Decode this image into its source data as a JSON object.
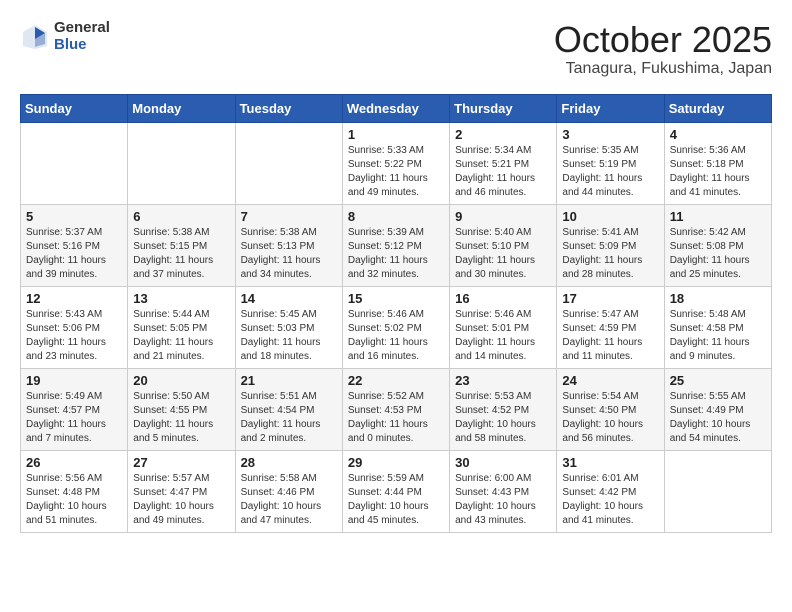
{
  "header": {
    "logo_general": "General",
    "logo_blue": "Blue",
    "month_title": "October 2025",
    "location": "Tanagura, Fukushima, Japan"
  },
  "weekdays": [
    "Sunday",
    "Monday",
    "Tuesday",
    "Wednesday",
    "Thursday",
    "Friday",
    "Saturday"
  ],
  "weeks": [
    [
      {
        "day": "",
        "info": ""
      },
      {
        "day": "",
        "info": ""
      },
      {
        "day": "",
        "info": ""
      },
      {
        "day": "1",
        "info": "Sunrise: 5:33 AM\nSunset: 5:22 PM\nDaylight: 11 hours\nand 49 minutes."
      },
      {
        "day": "2",
        "info": "Sunrise: 5:34 AM\nSunset: 5:21 PM\nDaylight: 11 hours\nand 46 minutes."
      },
      {
        "day": "3",
        "info": "Sunrise: 5:35 AM\nSunset: 5:19 PM\nDaylight: 11 hours\nand 44 minutes."
      },
      {
        "day": "4",
        "info": "Sunrise: 5:36 AM\nSunset: 5:18 PM\nDaylight: 11 hours\nand 41 minutes."
      }
    ],
    [
      {
        "day": "5",
        "info": "Sunrise: 5:37 AM\nSunset: 5:16 PM\nDaylight: 11 hours\nand 39 minutes."
      },
      {
        "day": "6",
        "info": "Sunrise: 5:38 AM\nSunset: 5:15 PM\nDaylight: 11 hours\nand 37 minutes."
      },
      {
        "day": "7",
        "info": "Sunrise: 5:38 AM\nSunset: 5:13 PM\nDaylight: 11 hours\nand 34 minutes."
      },
      {
        "day": "8",
        "info": "Sunrise: 5:39 AM\nSunset: 5:12 PM\nDaylight: 11 hours\nand 32 minutes."
      },
      {
        "day": "9",
        "info": "Sunrise: 5:40 AM\nSunset: 5:10 PM\nDaylight: 11 hours\nand 30 minutes."
      },
      {
        "day": "10",
        "info": "Sunrise: 5:41 AM\nSunset: 5:09 PM\nDaylight: 11 hours\nand 28 minutes."
      },
      {
        "day": "11",
        "info": "Sunrise: 5:42 AM\nSunset: 5:08 PM\nDaylight: 11 hours\nand 25 minutes."
      }
    ],
    [
      {
        "day": "12",
        "info": "Sunrise: 5:43 AM\nSunset: 5:06 PM\nDaylight: 11 hours\nand 23 minutes."
      },
      {
        "day": "13",
        "info": "Sunrise: 5:44 AM\nSunset: 5:05 PM\nDaylight: 11 hours\nand 21 minutes."
      },
      {
        "day": "14",
        "info": "Sunrise: 5:45 AM\nSunset: 5:03 PM\nDaylight: 11 hours\nand 18 minutes."
      },
      {
        "day": "15",
        "info": "Sunrise: 5:46 AM\nSunset: 5:02 PM\nDaylight: 11 hours\nand 16 minutes."
      },
      {
        "day": "16",
        "info": "Sunrise: 5:46 AM\nSunset: 5:01 PM\nDaylight: 11 hours\nand 14 minutes."
      },
      {
        "day": "17",
        "info": "Sunrise: 5:47 AM\nSunset: 4:59 PM\nDaylight: 11 hours\nand 11 minutes."
      },
      {
        "day": "18",
        "info": "Sunrise: 5:48 AM\nSunset: 4:58 PM\nDaylight: 11 hours\nand 9 minutes."
      }
    ],
    [
      {
        "day": "19",
        "info": "Sunrise: 5:49 AM\nSunset: 4:57 PM\nDaylight: 11 hours\nand 7 minutes."
      },
      {
        "day": "20",
        "info": "Sunrise: 5:50 AM\nSunset: 4:55 PM\nDaylight: 11 hours\nand 5 minutes."
      },
      {
        "day": "21",
        "info": "Sunrise: 5:51 AM\nSunset: 4:54 PM\nDaylight: 11 hours\nand 2 minutes."
      },
      {
        "day": "22",
        "info": "Sunrise: 5:52 AM\nSunset: 4:53 PM\nDaylight: 11 hours\nand 0 minutes."
      },
      {
        "day": "23",
        "info": "Sunrise: 5:53 AM\nSunset: 4:52 PM\nDaylight: 10 hours\nand 58 minutes."
      },
      {
        "day": "24",
        "info": "Sunrise: 5:54 AM\nSunset: 4:50 PM\nDaylight: 10 hours\nand 56 minutes."
      },
      {
        "day": "25",
        "info": "Sunrise: 5:55 AM\nSunset: 4:49 PM\nDaylight: 10 hours\nand 54 minutes."
      }
    ],
    [
      {
        "day": "26",
        "info": "Sunrise: 5:56 AM\nSunset: 4:48 PM\nDaylight: 10 hours\nand 51 minutes."
      },
      {
        "day": "27",
        "info": "Sunrise: 5:57 AM\nSunset: 4:47 PM\nDaylight: 10 hours\nand 49 minutes."
      },
      {
        "day": "28",
        "info": "Sunrise: 5:58 AM\nSunset: 4:46 PM\nDaylight: 10 hours\nand 47 minutes."
      },
      {
        "day": "29",
        "info": "Sunrise: 5:59 AM\nSunset: 4:44 PM\nDaylight: 10 hours\nand 45 minutes."
      },
      {
        "day": "30",
        "info": "Sunrise: 6:00 AM\nSunset: 4:43 PM\nDaylight: 10 hours\nand 43 minutes."
      },
      {
        "day": "31",
        "info": "Sunrise: 6:01 AM\nSunset: 4:42 PM\nDaylight: 10 hours\nand 41 minutes."
      },
      {
        "day": "",
        "info": ""
      }
    ]
  ]
}
